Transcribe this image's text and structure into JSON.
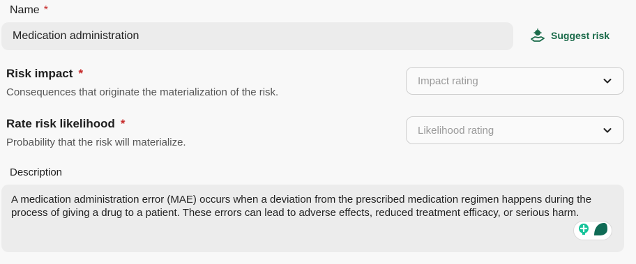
{
  "name_field": {
    "label": "Name",
    "required_mark": "*",
    "value": "Medication administration"
  },
  "suggest_button": {
    "label": "Suggest risk",
    "icon": "hand-sparkle-icon"
  },
  "risk_impact": {
    "title": "Risk impact",
    "required_mark": "*",
    "subtitle": "Consequences that originate the materialization of the risk.",
    "placeholder": "Impact rating"
  },
  "likelihood": {
    "title": "Rate risk likelihood",
    "required_mark": "*",
    "subtitle": "Probability that the risk will materialize.",
    "placeholder": "Likelihood rating"
  },
  "description": {
    "label": "Description",
    "value": "A medication administration error (MAE) occurs when a deviation from the prescribed medication regimen happens during the process of giving a drug to a patient. These errors can lead to adverse effects, reduced treatment efficacy, or serious harm."
  },
  "colors": {
    "accent": "#1b6b4a",
    "required": "#c62828",
    "input_bg": "#ececec"
  }
}
